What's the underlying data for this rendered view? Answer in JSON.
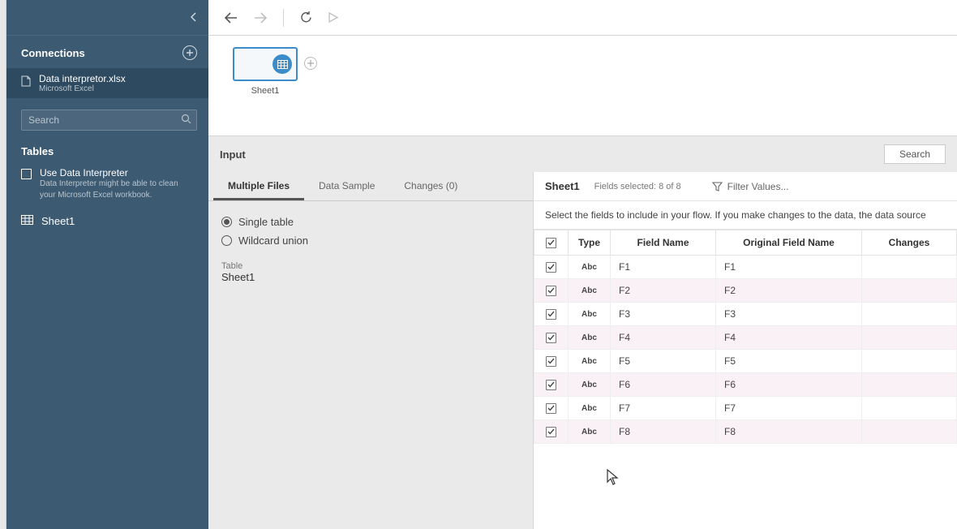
{
  "sidebar": {
    "connections_label": "Connections",
    "connection": {
      "name": "Data interpretor.xlsx",
      "type": "Microsoft Excel"
    },
    "search_placeholder": "Search",
    "tables_label": "Tables",
    "interpreter_label": "Use Data Interpreter",
    "interpreter_desc": "Data Interpreter might be able to clean your Microsoft Excel workbook.",
    "table_item": "Sheet1"
  },
  "canvas": {
    "node_label": "Sheet1"
  },
  "lower": {
    "title": "Input",
    "search_label": "Search",
    "tabs": [
      "Multiple Files",
      "Data Sample",
      "Changes (0)"
    ],
    "radios": {
      "single": "Single table",
      "wildcard": "Wildcard union"
    },
    "table_label": "Table",
    "table_value": "Sheet1"
  },
  "right": {
    "title": "Sheet1",
    "fields_selected": "Fields selected: 8 of 8",
    "filter_label": "Filter Values...",
    "desc": "Select the fields to include in your flow. If you make changes to the data, the data source",
    "columns": {
      "type": "Type",
      "field_name": "Field Name",
      "original_field_name": "Original Field Name",
      "changes": "Changes"
    },
    "type_token": "Abc",
    "rows": [
      {
        "field": "F1",
        "original": "F1"
      },
      {
        "field": "F2",
        "original": "F2"
      },
      {
        "field": "F3",
        "original": "F3"
      },
      {
        "field": "F4",
        "original": "F4"
      },
      {
        "field": "F5",
        "original": "F5"
      },
      {
        "field": "F6",
        "original": "F6"
      },
      {
        "field": "F7",
        "original": "F7"
      },
      {
        "field": "F8",
        "original": "F8"
      }
    ]
  }
}
